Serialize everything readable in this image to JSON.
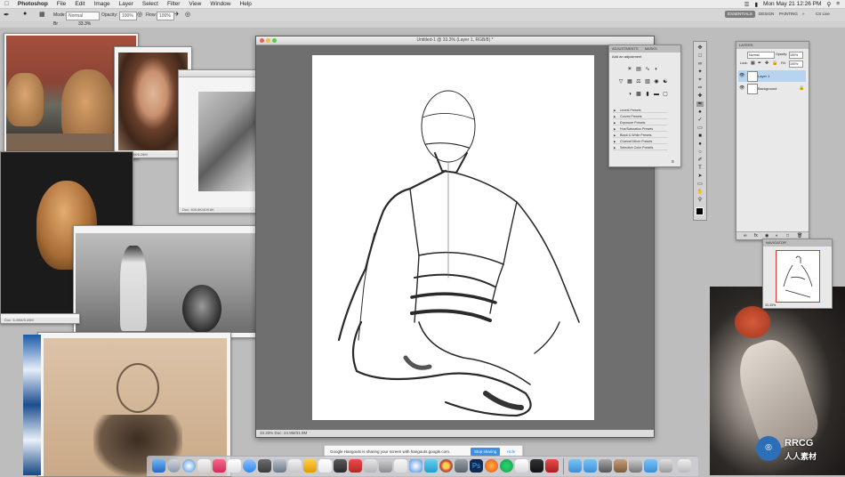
{
  "menubar": {
    "app": "Photoshop",
    "items": [
      "File",
      "Edit",
      "Image",
      "Layer",
      "Select",
      "Filter",
      "View",
      "Window",
      "Help"
    ],
    "clock": "Mon May 21 12:26 PM"
  },
  "optionsbar": {
    "zoom": "33.3%",
    "mode_label": "Mode:",
    "mode_value": "Normal",
    "opacity_label": "Opacity:",
    "opacity_value": "100%",
    "flow_label": "Flow:",
    "flow_value": "100%",
    "workspaces": [
      "ESSENTIALS",
      "DESIGN",
      "PAINTING"
    ],
    "active_workspace": "ESSENTIALS",
    "cs_live": "CS Live"
  },
  "document": {
    "title": "Untitled-1 @ 33.3% (Layer 1, RGB/8) *",
    "status": "33.33%  Doc: 24.9M/31.9M"
  },
  "photo_windows": [
    {
      "status": "Doc: 18.5M/18.5M"
    },
    {
      "status": "Doc: 6.28M/6.28M"
    },
    {
      "status": "Doc: 409.6K/409.6K"
    },
    {
      "status": "Doc: 13.8M/13.8M"
    },
    {
      "status": "Doc: 5.49M/5.49M"
    },
    {
      "status": "Doc: 10.1M/10.1M"
    }
  ],
  "adjustments": {
    "tabs": [
      "ADJUSTMENTS",
      "MASKS"
    ],
    "header": "Add an adjustment",
    "presets": [
      "Levels Presets",
      "Curves Presets",
      "Exposure Presets",
      "Hue/Saturation Presets",
      "Black & White Presets",
      "Channel Mixer Presets",
      "Selective Color Presets"
    ]
  },
  "layers": {
    "tabs": [
      "LAYERS",
      "CHANNELS",
      "PATHS"
    ],
    "blend_mode": "Normal",
    "opacity_label": "Opacity:",
    "opacity": "100%",
    "fill_label": "Fill:",
    "fill": "100%",
    "lock_label": "Lock:",
    "items": [
      {
        "name": "Layer 1",
        "selected": true
      },
      {
        "name": "Background",
        "selected": false
      }
    ]
  },
  "navigator": {
    "tabs": [
      "NAVIGATOR",
      "HISTOGRAM",
      "INFO"
    ],
    "zoom": "33.33%"
  },
  "hangouts": {
    "message": "Google Hangouts is sharing your screen with hangouts.google.com.",
    "stop_label": "Stop sharing",
    "hide_label": "Hide"
  },
  "watermark": {
    "text": "RRCG",
    "subtext": "人人素材"
  },
  "colors": {
    "accent": "#3e8fe6",
    "menubar": "#ececec",
    "workspace_bg": "#bdbdbd"
  }
}
